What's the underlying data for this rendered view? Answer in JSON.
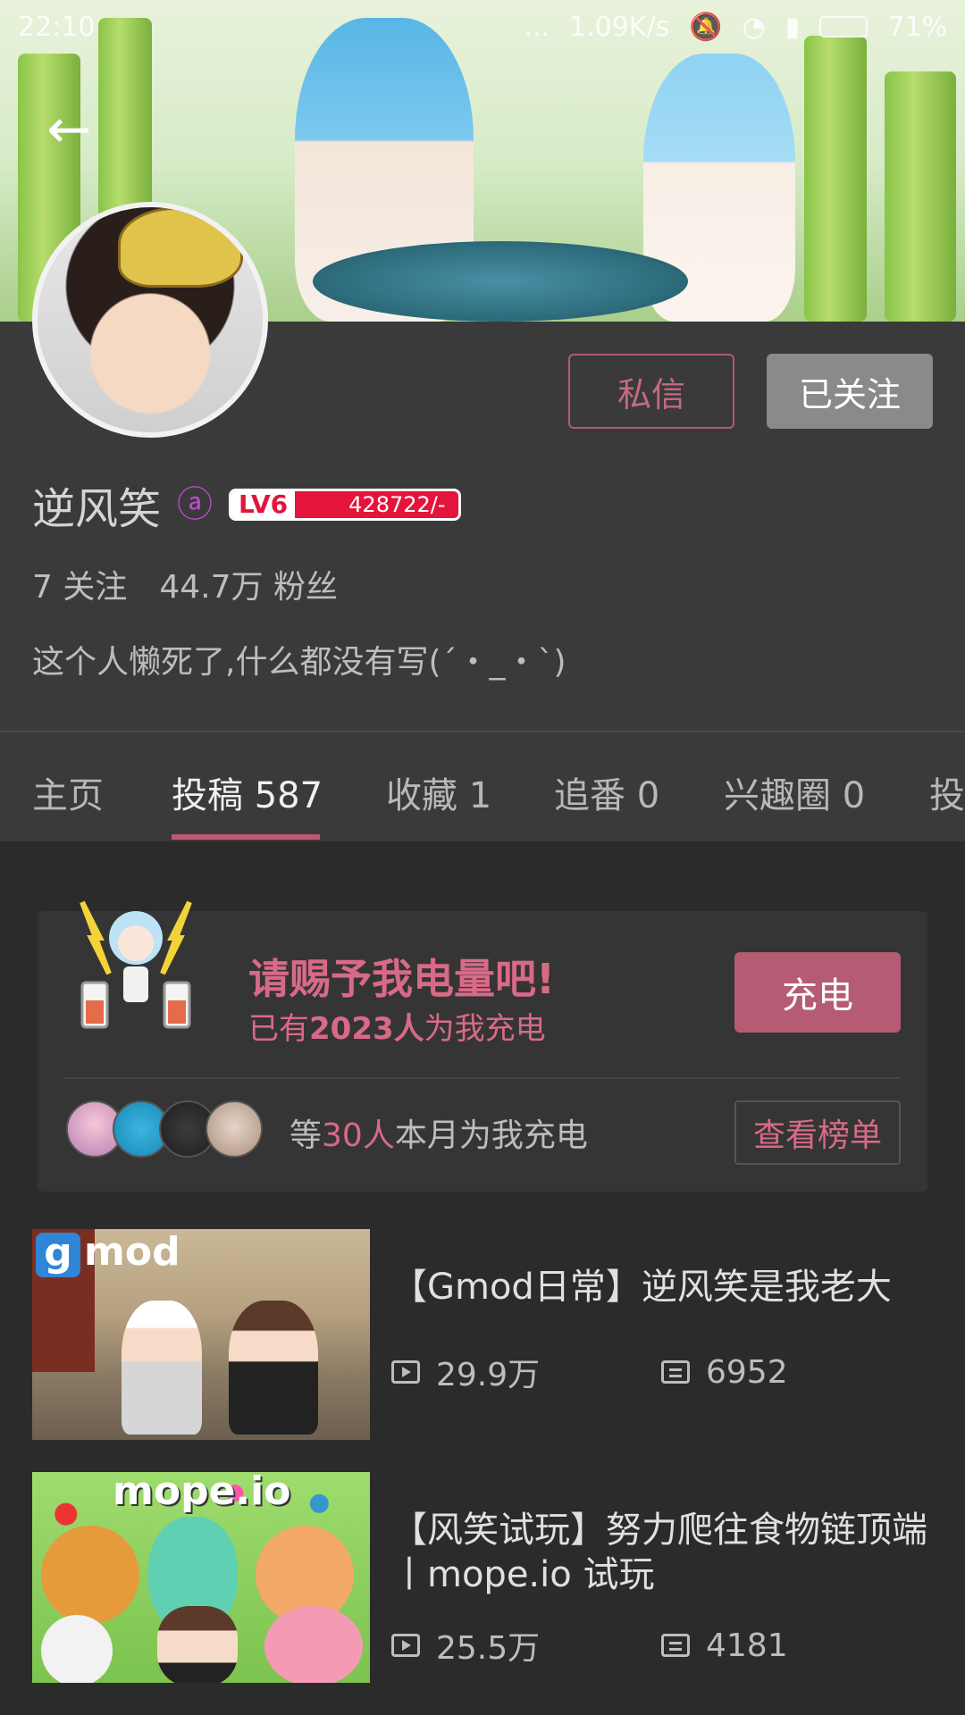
{
  "status_bar": {
    "time": "22:10",
    "dots": "...",
    "speed": "1.09K/s",
    "battery": "71%"
  },
  "profile": {
    "name": "逆风笑",
    "level": "LV6",
    "exp": "428722/-",
    "following": "7 关注",
    "fans": "44.7万 粉丝",
    "signature": "这个人懒死了,什么都没有写(´・_・`)"
  },
  "buttons": {
    "message": "私信",
    "followed": "已关注"
  },
  "tabs": [
    {
      "label": "主页"
    },
    {
      "label": "投稿 587"
    },
    {
      "label": "收藏 1"
    },
    {
      "label": "追番 0"
    },
    {
      "label": "兴趣圈 0"
    },
    {
      "label": "投"
    }
  ],
  "charge": {
    "title": "请赐予我电量吧!",
    "sub_prefix": "已有",
    "sub_count": "2023人",
    "sub_suffix": "为我充电",
    "button": "充电",
    "rank_prefix": "等",
    "rank_count": "30人",
    "rank_suffix": "本月为我充电",
    "rank_button": "查看榜单"
  },
  "videos": [
    {
      "title": "【Gmod日常】逆风笑是我老大",
      "plays": "29.9万",
      "danmaku": "6952",
      "thumb_text": "mod",
      "thumb_badge": "g"
    },
    {
      "title": "【风笑试玩】努力爬往食物链顶端丨mope.io 试玩",
      "plays": "25.5万",
      "danmaku": "4181",
      "thumb_text": "mope.io"
    }
  ],
  "colors": {
    "accent": "#c05873",
    "background": "#2b2b2b",
    "header_bg": "#3a3a3a",
    "level_red": "#e4143c"
  }
}
